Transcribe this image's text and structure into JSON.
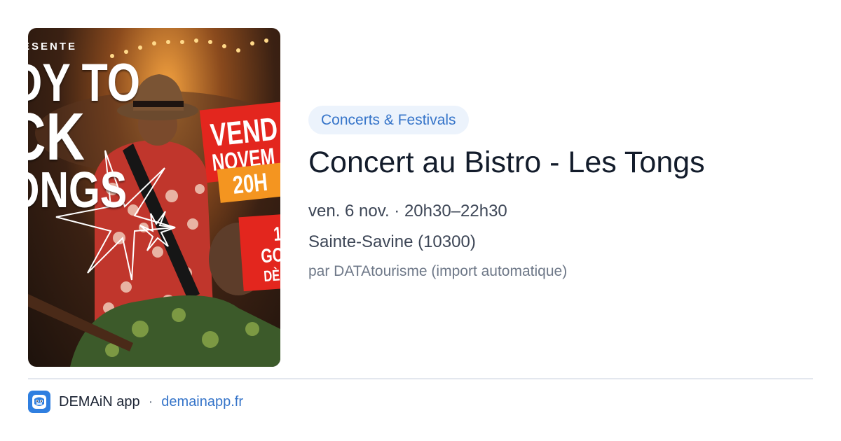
{
  "poster": {
    "presente_text": "ÉSENTE",
    "title_line1": "DY TO",
    "title_line2": "CK",
    "title_line3": "ONGS",
    "date_line1": "VEND",
    "date_line2": "NOVEM",
    "time_text": "20H",
    "info_line1": "1",
    "info_line2": "GO",
    "info_line3": "DÈS"
  },
  "event": {
    "category": "Concerts & Festivals",
    "title": "Concert au Bistro - Les Tongs",
    "datetime": "ven. 6 nov. · 20h30–22h30",
    "location": "Sainte-Savine (10300)",
    "source": "par DATAtourisme (import automatique)"
  },
  "footer": {
    "app_name": "DEMAiN app",
    "separator": "·",
    "domain": "demainapp.fr"
  },
  "colors": {
    "accent": "#3574c9",
    "category_bg": "#ecf3fc",
    "title": "#131c2b",
    "app_icon": "#2f7fe0"
  },
  "icons": {
    "app": "demain-app-icon"
  }
}
